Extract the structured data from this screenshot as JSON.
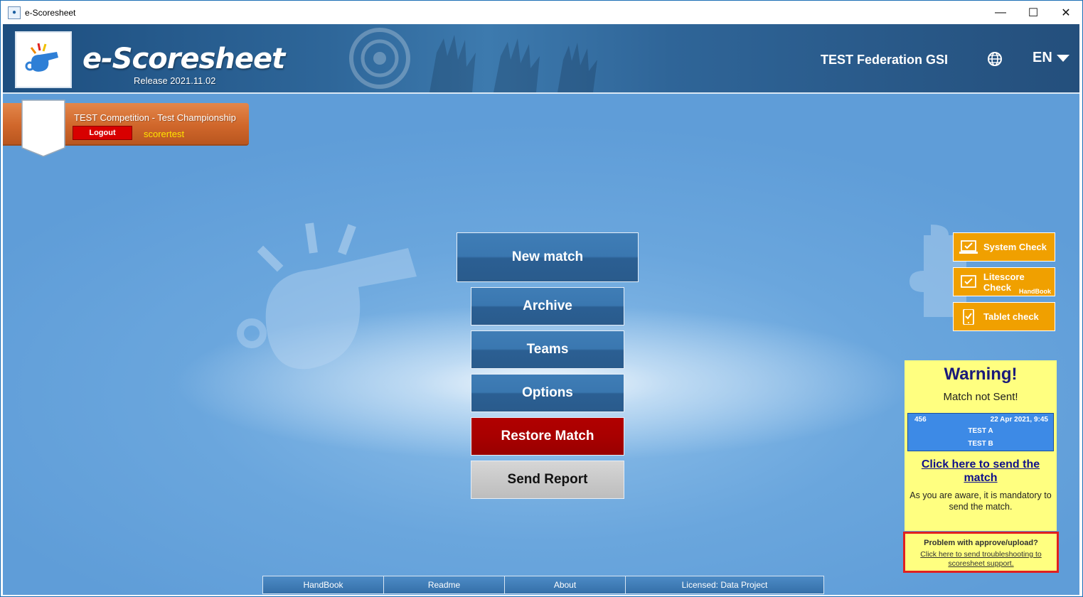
{
  "window": {
    "title": "e-Scoresheet",
    "controls": {
      "minimize": "—",
      "maximize": "☐",
      "close": "✕"
    }
  },
  "header": {
    "brand": "e-Scoresheet",
    "release": "Release 2021.11.02",
    "federation": "TEST Federation GSI",
    "language": "EN",
    "icons": {
      "logo": "whistle-icon",
      "globe": "globe-icon"
    }
  },
  "session": {
    "competition": "TEST Competition - Test Championship",
    "logout_label": "Logout",
    "username": "scorertest"
  },
  "menu": {
    "new_match": "New match",
    "archive": "Archive",
    "teams": "Teams",
    "options": "Options",
    "restore_match": "Restore Match",
    "send_report": "Send Report"
  },
  "checks": {
    "system": "System Check",
    "litescore": "Litescore Check",
    "litescore_sub": "HandBook",
    "tablet": "Tablet check"
  },
  "warning": {
    "title": "Warning!",
    "subtitle": "Match not Sent!",
    "match": {
      "number": "456",
      "datetime": "22 Apr 2021, 9:45",
      "team_a": "TEST A",
      "team_b": "TEST B"
    },
    "send_link": "Click here to send the match",
    "mandatory_text": "As you are aware, it is mandatory to send the match."
  },
  "support": {
    "title": "Problem with approve/upload?",
    "link": "Click here to send troubleshooting to scoresheet support."
  },
  "footer": {
    "handbook": "HandBook",
    "readme": "Readme",
    "about": "About",
    "license": "Licensed: Data Project"
  },
  "colors": {
    "header": "#2e6699",
    "background": "#64a2dc",
    "button_blue": "#3a77b0",
    "restore_red": "#a80000",
    "check_orange": "#f0a000",
    "warning_yellow": "#ffff80",
    "support_border": "#e02020"
  }
}
